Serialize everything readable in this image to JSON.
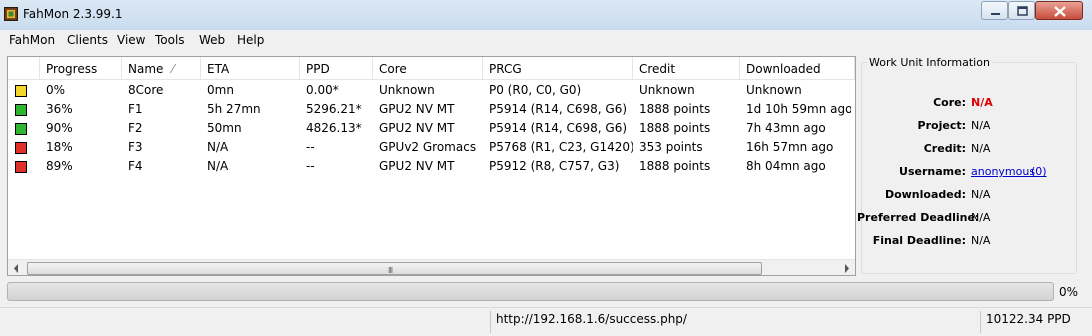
{
  "window": {
    "title": "FahMon 2.3.99.1"
  },
  "menu": [
    "FahMon",
    "Clients",
    "View",
    "Tools",
    "Web",
    "Help"
  ],
  "list": {
    "columns": [
      "Progress",
      "Name",
      "ETA",
      "PPD",
      "Core",
      "PRCG",
      "Credit",
      "Downloaded"
    ],
    "sort_indicator": "⁄",
    "rows": [
      {
        "status_color": "#f4d52a",
        "progress": "0%",
        "name": "8Core",
        "eta": "0mn",
        "ppd": "0.00*",
        "core": "Unknown",
        "prcg": "P0 (R0, C0, G0)",
        "credit": "Unknown",
        "downloaded": "Unknown"
      },
      {
        "status_color": "#2fb52f",
        "progress": "36%",
        "name": "F1",
        "eta": "5h 27mn",
        "ppd": "5296.21*",
        "core": "GPU2 NV MT",
        "prcg": "P5914 (R14, C698, G6)",
        "credit": "1888 points",
        "downloaded": "1d 10h 59mn ago"
      },
      {
        "status_color": "#2fb52f",
        "progress": "90%",
        "name": "F2",
        "eta": "50mn",
        "ppd": "4826.13*",
        "core": "GPU2 NV MT",
        "prcg": "P5914 (R14, C698, G6)",
        "credit": "1888 points",
        "downloaded": "7h 43mn ago"
      },
      {
        "status_color": "#e0302a",
        "progress": "18%",
        "name": "F3",
        "eta": "N/A",
        "ppd": "--",
        "core": "GPUv2 Gromacs",
        "prcg": "P5768 (R1, C23, G1420)",
        "credit": "353 points",
        "downloaded": "16h 57mn ago"
      },
      {
        "status_color": "#e0302a",
        "progress": "89%",
        "name": "F4",
        "eta": "N/A",
        "ppd": "--",
        "core": "GPU2 NV MT",
        "prcg": "P5912 (R8, C757, G3)",
        "credit": "1888 points",
        "downloaded": "8h 04mn ago"
      }
    ],
    "scroll_grip": "III"
  },
  "work_unit": {
    "title": "Work Unit Information",
    "fields": [
      {
        "label": "Core:",
        "value": "N/A"
      },
      {
        "label": "Project:",
        "value": "N/A"
      },
      {
        "label": "Credit:",
        "value": "N/A"
      },
      {
        "label": "Username:",
        "value": "anonymous",
        "extra": "(0)"
      },
      {
        "label": "Downloaded:",
        "value": "N/A"
      },
      {
        "label": "Preferred Deadline:",
        "value": "N/A"
      },
      {
        "label": "Final Deadline:",
        "value": "N/A"
      }
    ],
    "core_value_color": "#e00000"
  },
  "progress": {
    "label": "0%",
    "fraction": 0
  },
  "statusbar": {
    "url": "http://192.168.1.6/success.php/",
    "total_ppd": "10122.34 PPD"
  }
}
